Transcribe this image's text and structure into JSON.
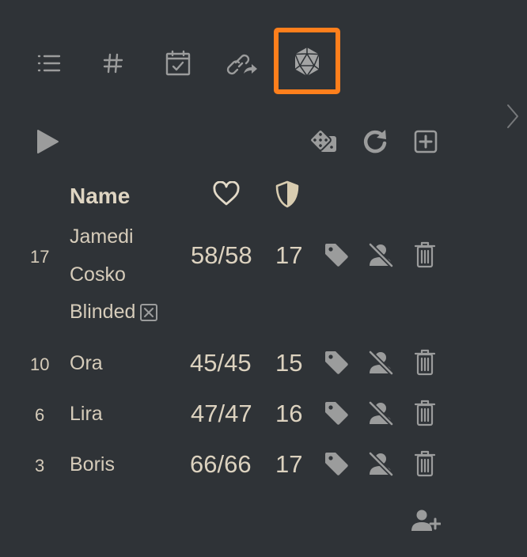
{
  "tabs": [
    {
      "icon": "list-icon"
    },
    {
      "icon": "hash-icon"
    },
    {
      "icon": "calendar-check-icon"
    },
    {
      "icon": "link-share-icon"
    },
    {
      "icon": "d20-dice-icon",
      "active": true
    }
  ],
  "toolbar": {
    "play_icon": "play-icon",
    "dice_icon": "dice-icon",
    "reset_icon": "reset-icon",
    "add_icon": "add-square-icon"
  },
  "table": {
    "columns": {
      "name": "Name",
      "hp_icon": "heart-icon",
      "ac_icon": "shield-icon"
    },
    "rows": [
      {
        "initiative": "17",
        "name_lines": [
          "Jamedi",
          "Cosko"
        ],
        "status": "Blinded",
        "hp": "58/58",
        "ac": "17"
      },
      {
        "initiative": "10",
        "name": "Ora",
        "hp": "45/45",
        "ac": "15"
      },
      {
        "initiative": "6",
        "name": "Lira",
        "hp": "47/47",
        "ac": "16"
      },
      {
        "initiative": "3",
        "name": "Boris",
        "hp": "66/66",
        "ac": "17"
      }
    ]
  },
  "footer": {
    "add_creature_icon": "add-user-icon"
  },
  "colors": {
    "background": "#2f3337",
    "text": "#d9cfbd",
    "icon": "#9b9c9c",
    "active_highlight": "#fe7f1c"
  }
}
